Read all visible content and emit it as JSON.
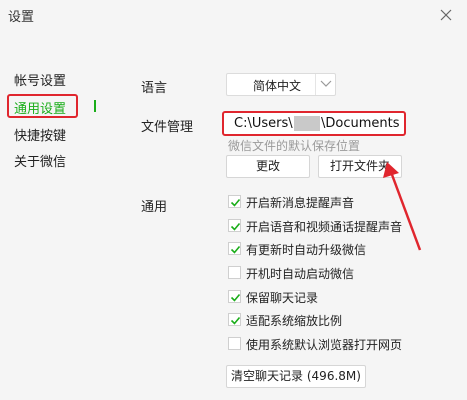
{
  "window": {
    "title": "设置"
  },
  "sidebar": {
    "items": [
      {
        "label": "帐号设置",
        "active": false
      },
      {
        "label": "通用设置",
        "active": true
      },
      {
        "label": "快捷按键",
        "active": false
      },
      {
        "label": "关于微信",
        "active": false
      }
    ]
  },
  "language": {
    "label": "语言",
    "value": "简体中文"
  },
  "file_management": {
    "label": "文件管理",
    "path_prefix": "C:\\Users\\",
    "path_suffix": "\\Documents",
    "hint": "微信文件的默认保存位置",
    "change_button": "更改",
    "open_folder_button": "打开文件夹"
  },
  "general": {
    "label": "通用",
    "options": [
      {
        "label": "开启新消息提醒声音",
        "checked": true
      },
      {
        "label": "开启语音和视频通话提醒声音",
        "checked": true
      },
      {
        "label": "有更新时自动升级微信",
        "checked": true
      },
      {
        "label": "开机时自动启动微信",
        "checked": false
      },
      {
        "label": "保留聊天记录",
        "checked": true
      },
      {
        "label": "适配系统缩放比例",
        "checked": true
      },
      {
        "label": "使用系统默认浏览器打开网页",
        "checked": false
      }
    ],
    "clear_chat_button": "清空聊天记录 (496.8M)"
  },
  "colors": {
    "accent": "#1aad19",
    "highlight": "#e0262e"
  }
}
